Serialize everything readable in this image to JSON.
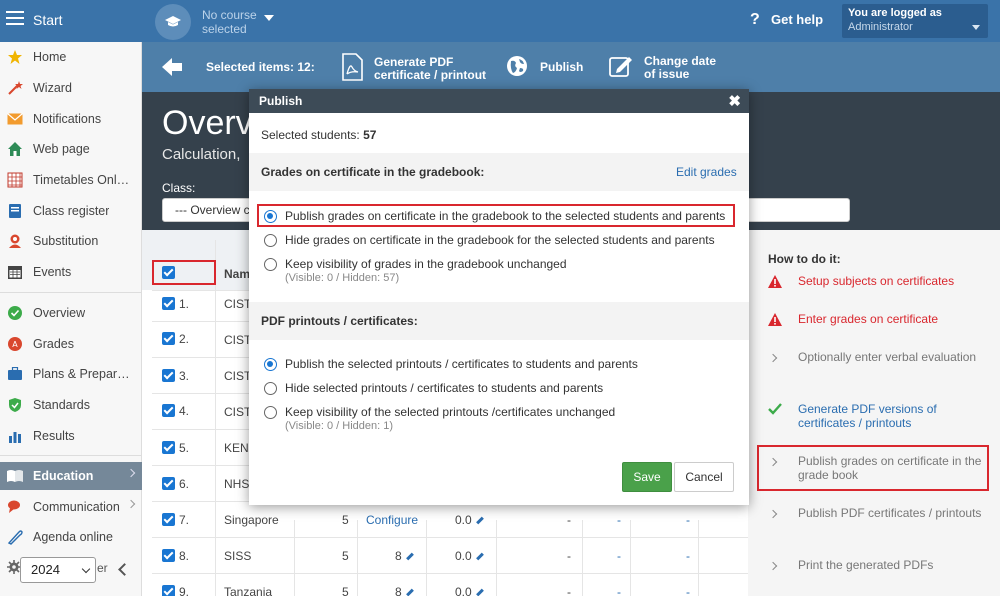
{
  "topbar": {
    "start_label": "Start",
    "course_line1": "No course",
    "course_line2": "selected",
    "help_symbol": "?",
    "help_label": "Get help",
    "login_line1": "You are logged as",
    "login_line2": "Administrator"
  },
  "sidebar": {
    "items": [
      {
        "label": "Home",
        "icon": "star-icon"
      },
      {
        "label": "Wizard",
        "icon": "wizard-icon"
      },
      {
        "label": "Notifications",
        "icon": "envelope-icon"
      },
      {
        "label": "Web page",
        "icon": "house-icon"
      },
      {
        "label": "Timetables Onl…",
        "icon": "timetable-icon"
      },
      {
        "label": "Class register",
        "icon": "register-icon"
      },
      {
        "label": "Substitution",
        "icon": "substitution-icon"
      },
      {
        "label": "Events",
        "icon": "calendar-icon"
      },
      {
        "label": "Overview",
        "icon": "check-circle-icon"
      },
      {
        "label": "Grades",
        "icon": "grades-icon"
      },
      {
        "label": "Plans & Prepar…",
        "icon": "briefcase-icon"
      },
      {
        "label": "Standards",
        "icon": "shield-icon"
      },
      {
        "label": "Results",
        "icon": "bar-chart-icon"
      },
      {
        "label": "Education",
        "icon": "book-icon"
      },
      {
        "label": "Communication",
        "icon": "chat-icon"
      },
      {
        "label": "Agenda online",
        "icon": "agenda-icon"
      }
    ],
    "settings_label_fragment": "er",
    "year_value": "2024"
  },
  "toolbar": {
    "selected_label": "Selected items: 12:",
    "pdf_line1": "Generate PDF",
    "pdf_line2": "certificate / printout",
    "publish_label": "Publish",
    "date_line1": "Change date",
    "date_line2": "of issue"
  },
  "hero": {
    "title": "Overv",
    "subtitle": "Calculation,",
    "class_label": "Class:",
    "class_value": "--- Overview c"
  },
  "table": {
    "name_header": "Nam",
    "rows": [
      {
        "num": "1.",
        "name": "CIST",
        "count": "",
        "grade": "",
        "avg": "",
        "c1": "",
        "c2": "",
        "c3": ""
      },
      {
        "num": "2.",
        "name": "CIST",
        "count": "",
        "grade": "",
        "avg": "",
        "c1": "",
        "c2": "",
        "c3": ""
      },
      {
        "num": "3.",
        "name": "CIST",
        "count": "",
        "grade": "",
        "avg": "",
        "c1": "",
        "c2": "",
        "c3": ""
      },
      {
        "num": "4.",
        "name": "CIST",
        "count": "",
        "grade": "",
        "avg": "",
        "c1": "",
        "c2": "",
        "c3": ""
      },
      {
        "num": "5.",
        "name": "KEN",
        "count": "",
        "grade": "",
        "avg": "",
        "c1": "",
        "c2": "",
        "c3": ""
      },
      {
        "num": "6.",
        "name": "NHS",
        "count": "",
        "grade": "",
        "avg": "",
        "c1": "",
        "c2": "",
        "c3": ""
      },
      {
        "num": "7.",
        "name": "Singapore",
        "count": "5",
        "grade": "Configure",
        "avg": "0.0",
        "c1": "-",
        "c2": "-",
        "c3": "-"
      },
      {
        "num": "8.",
        "name": "SISS",
        "count": "5",
        "grade": "8",
        "avg": "0.0",
        "c1": "-",
        "c2": "-",
        "c3": "-"
      },
      {
        "num": "9.",
        "name": "Tanzania",
        "count": "5",
        "grade": "8",
        "avg": "0.0",
        "c1": "-",
        "c2": "-",
        "c3": "-"
      }
    ]
  },
  "howto": {
    "title": "How to do it:",
    "steps": [
      {
        "text": "Setup subjects on certificates",
        "status": "warning"
      },
      {
        "text": "Enter grades on certificate",
        "status": "warning"
      },
      {
        "text": "Optionally enter verbal evaluation",
        "status": "pending"
      },
      {
        "text": "Generate PDF versions of certificates / printouts",
        "status": "done"
      },
      {
        "text": "Publish grades on certificate in the grade book",
        "status": "pending"
      },
      {
        "text": "Publish PDF certificates / printouts",
        "status": "pending"
      },
      {
        "text": "Print the generated PDFs",
        "status": "pending"
      }
    ]
  },
  "modal": {
    "title": "Publish",
    "close_symbol": "✖",
    "selected_label": "Selected students:",
    "selected_count": "57",
    "section1_title": "Grades on certificate in the gradebook:",
    "edit_link": "Edit grades",
    "grade_options": [
      "Publish grades on certificate in the gradebook to the selected students and parents",
      "Hide grades on certificate in the gradebook for the selected students and parents",
      "Keep visibility of grades in the gradebook unchanged"
    ],
    "grade_visibility": "(Visible: 0 / Hidden: 57)",
    "section2_title": "PDF printouts / certificates:",
    "pdf_options": [
      "Publish the selected printouts / certificates to students and parents",
      "Hide selected printouts / certificates to students and parents",
      "Keep visibility of the selected printouts /certificates unchanged"
    ],
    "pdf_visibility": "(Visible: 0 / Hidden: 1)",
    "save_label": "Save",
    "cancel_label": "Cancel"
  },
  "colors": {
    "topbar": "#3a73a9",
    "toolbar": "#4e7fa9",
    "hero": "#35414c",
    "highlight": "#d9272e",
    "save": "#4aa14a",
    "radio": "#1976d2"
  }
}
